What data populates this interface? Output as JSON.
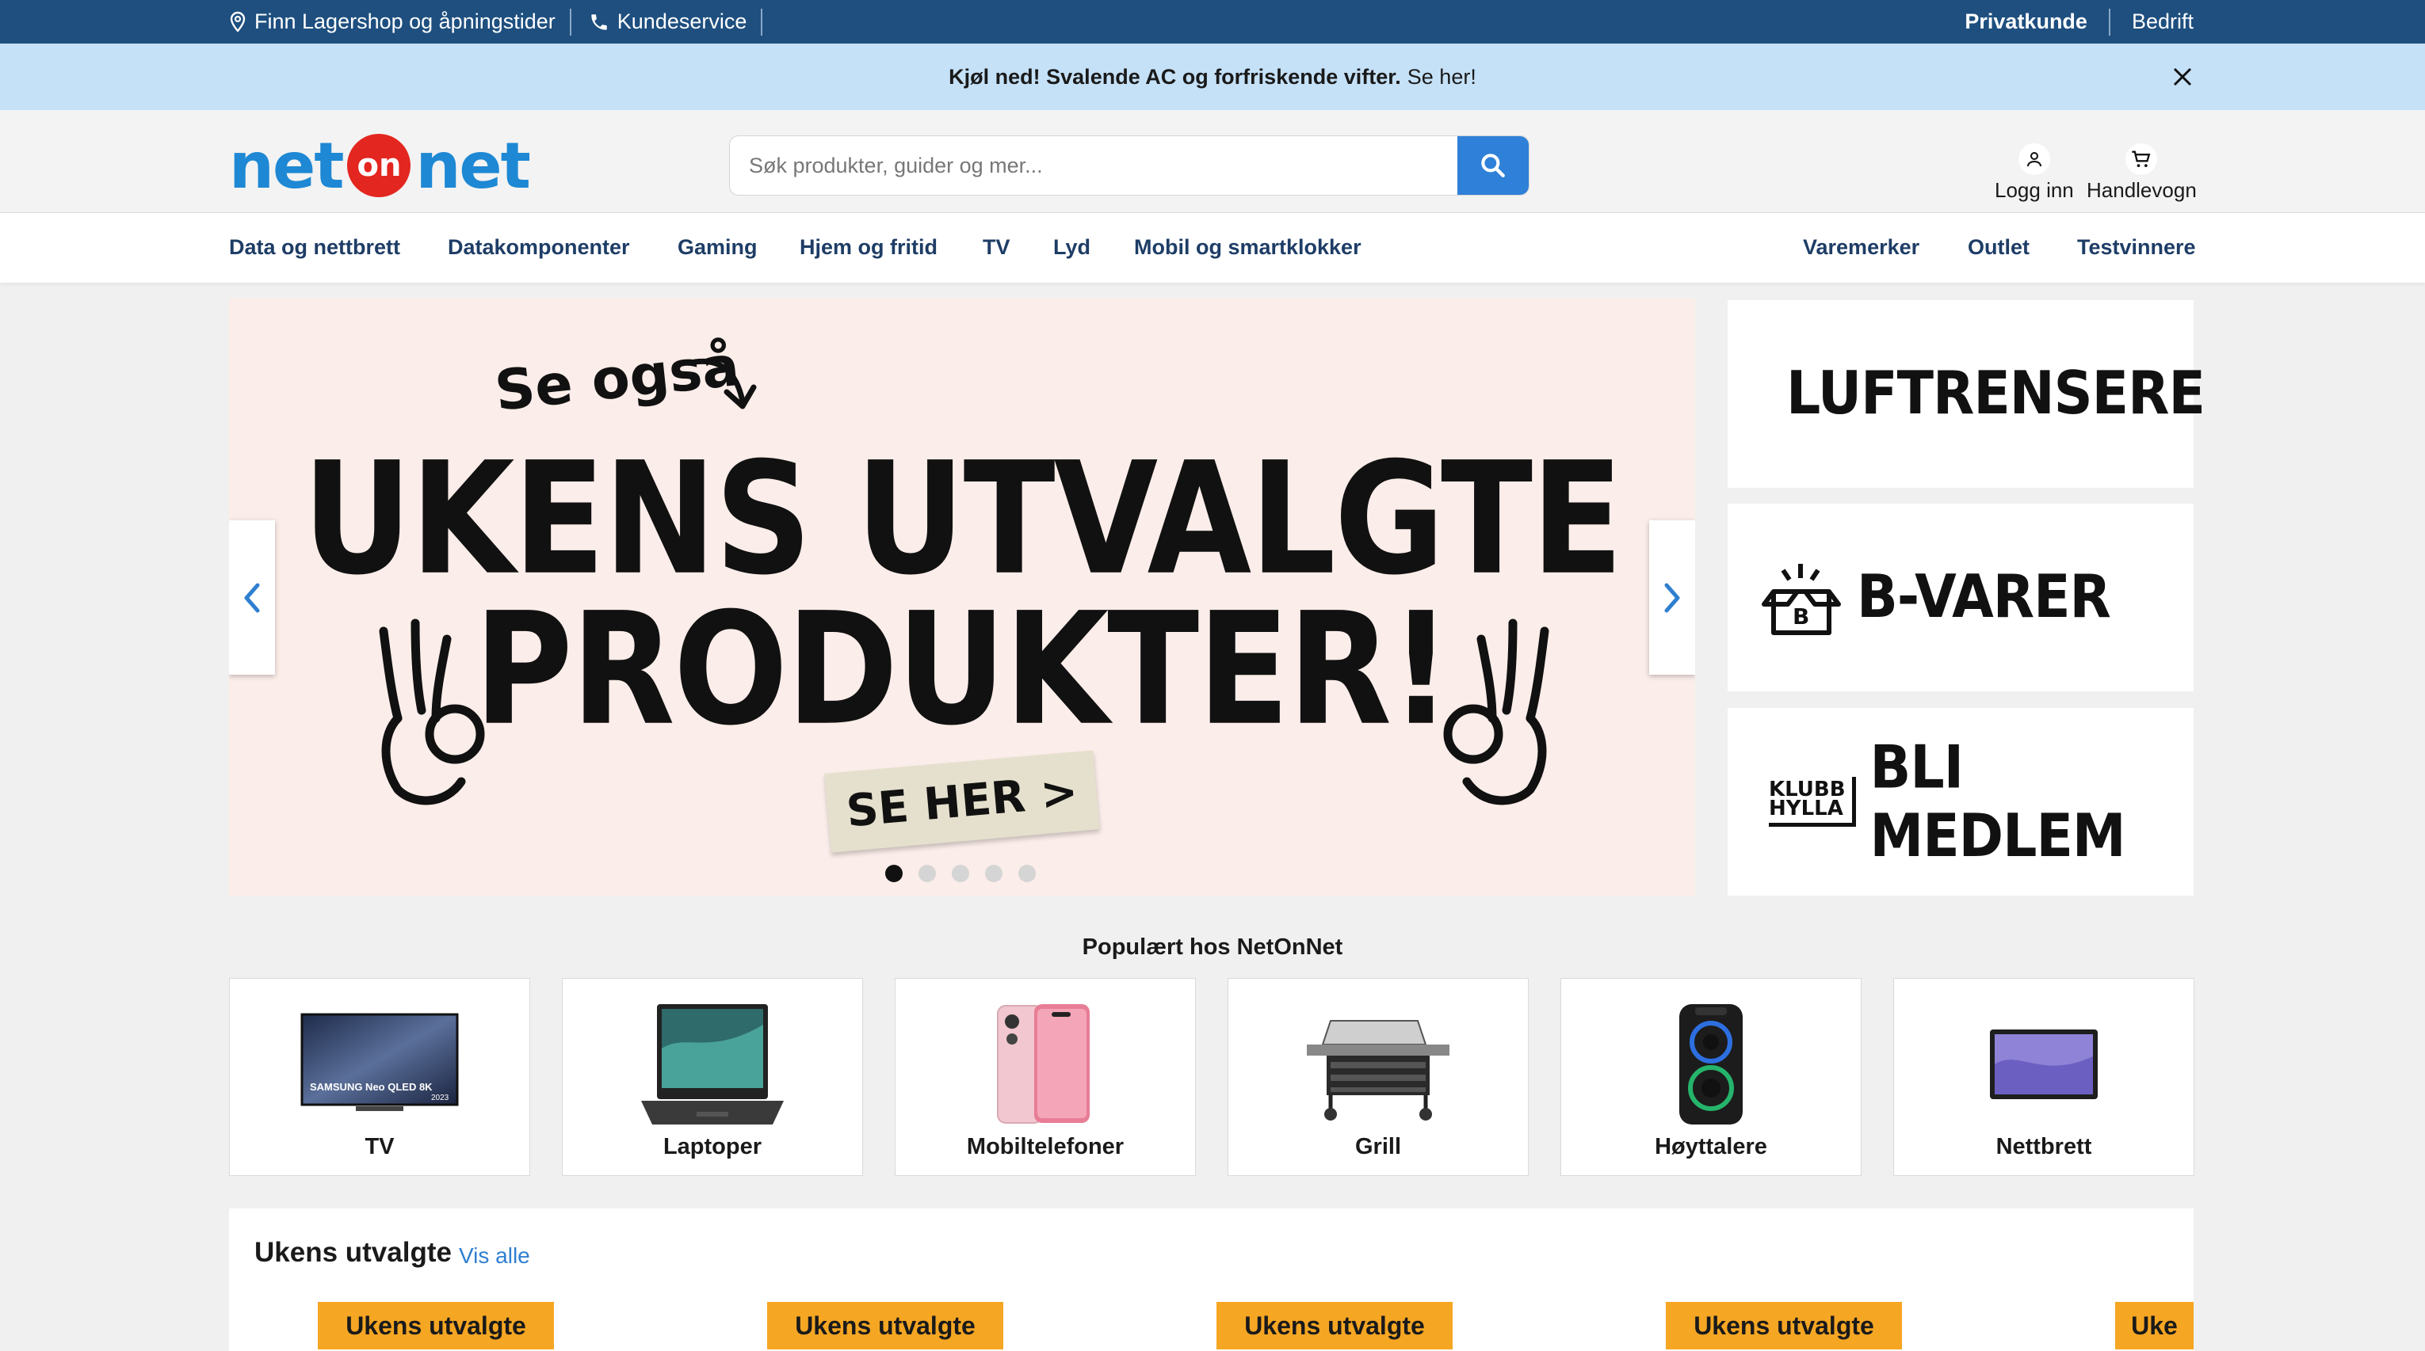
{
  "topbar": {
    "store_link": "Finn Lagershop og åpningstider",
    "service_link": "Kundeservice",
    "private": "Privatkunde",
    "business": "Bedrift"
  },
  "promo": {
    "bold": "Kjøl ned! Svalende AC og forfriskende vifter.",
    "link": "Se her!"
  },
  "header": {
    "logo_left": "net",
    "logo_mid": "on",
    "logo_right": "net",
    "search_placeholder": "Søk produkter, guider og mer...",
    "login": "Logg inn",
    "cart": "Handlevogn"
  },
  "nav": {
    "left": [
      "Data og nettbrett",
      "Datakomponenter",
      "Gaming",
      "Hjem og fritid",
      "TV",
      "Lyd",
      "Mobil og smartklokker"
    ],
    "right": [
      "Varemerker",
      "Outlet",
      "Testvinnere"
    ]
  },
  "hero": {
    "small": "Se også",
    "line1": "UKENS UTVALGTE",
    "line2": "PRODUKTER!",
    "cta": "SE HER >",
    "slides": 5,
    "active_slide": 1
  },
  "tiles": [
    "LUFTRENSERE",
    "B-VARER",
    "BLI MEDLEM"
  ],
  "tile_logo": [
    "KLUBB",
    "HYLLA"
  ],
  "popular": {
    "title": "Populært hos NetOnNet",
    "categories": [
      "TV",
      "Laptoper",
      "Mobiltelefoner",
      "Grill",
      "Høyttalere",
      "Nettbrett"
    ],
    "tv_brand": "SAMSUNG Neo QLED 8K",
    "tv_year": "2023"
  },
  "weekly": {
    "title": "Ukens utvalgte",
    "see_all": "Vis alle",
    "badges": [
      "Ukens utvalgte",
      "Ukens utvalgte",
      "Ukens utvalgte",
      "Ukens utvalgte",
      "Uke"
    ]
  },
  "colors": {
    "topbar": "#1e4f7f",
    "promo": "#c5e1f8",
    "brand_blue": "#1e88d4",
    "brand_red": "#e3261f",
    "search_button": "#2f80d8",
    "badge": "#f5a623"
  }
}
